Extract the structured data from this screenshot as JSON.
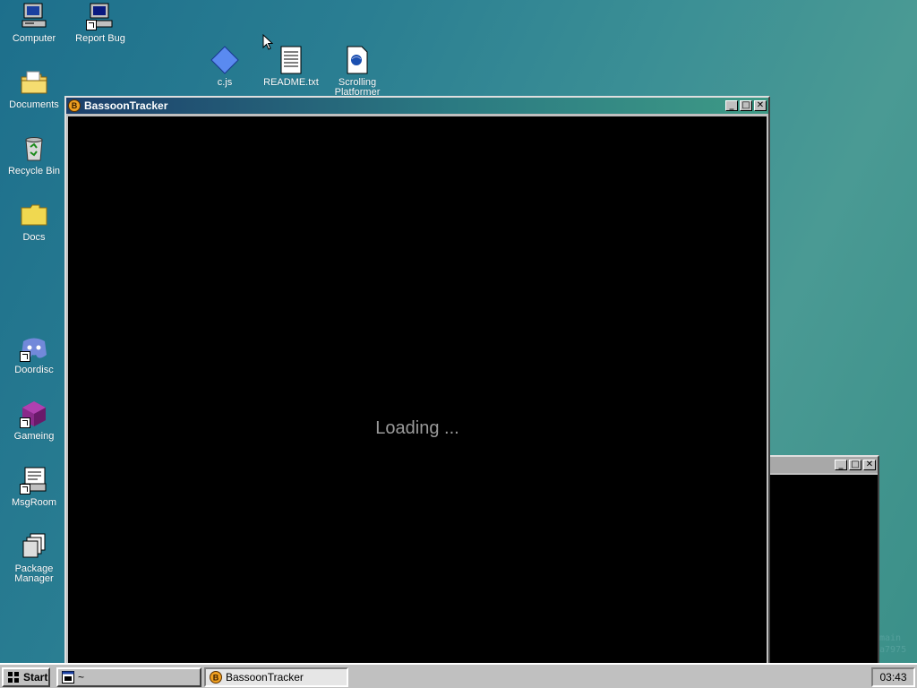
{
  "desktop": {
    "icons": [
      {
        "label": "Computer"
      },
      {
        "label": "Report Bug"
      },
      {
        "label": "Documents"
      },
      {
        "label": "Recycle Bin"
      },
      {
        "label": "Docs"
      },
      {
        "label": "Doordisc"
      },
      {
        "label": "Gameing"
      },
      {
        "label": "MsgRoom"
      },
      {
        "label": "Package Manager"
      },
      {
        "label": "c.js"
      },
      {
        "label": "README.txt"
      },
      {
        "label": "Scrolling Platformer"
      }
    ],
    "watermark_lines": [
      "main",
      "a7975"
    ]
  },
  "main_window": {
    "title": "BassoonTracker",
    "icon_letter": "B",
    "loading_text": "Loading ...",
    "minimize": "_",
    "maximize": "□",
    "close": "✕"
  },
  "second_window": {
    "minimize": "_",
    "maximize": "□",
    "close": "✕"
  },
  "taskbar": {
    "start_label": "Start",
    "items": [
      {
        "label": "~"
      },
      {
        "label": "BassoonTracker"
      }
    ],
    "clock": "03:43"
  },
  "colors": {
    "titlebar_active_start": "#1c3f6b",
    "titlebar_active_end": "#3e9a86",
    "desktop": "#2a7e92"
  }
}
